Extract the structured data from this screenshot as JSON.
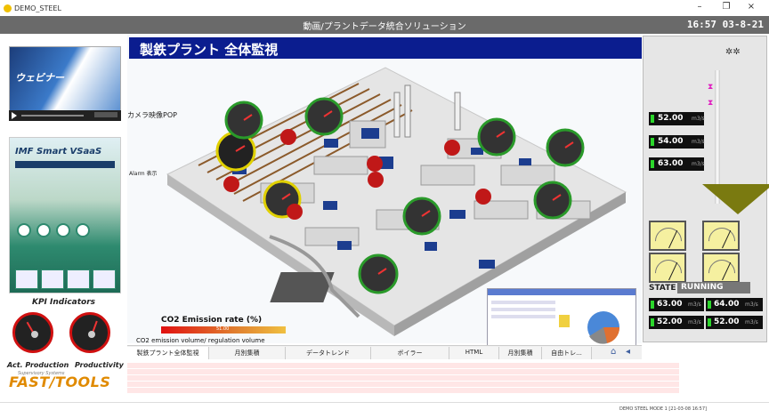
{
  "window": {
    "app_name": "DEMO_STEEL",
    "minimize": "–",
    "restore": "❐",
    "close": "×"
  },
  "banner": {
    "title": "動画/プラントデータ統合ソリューション",
    "clock": "16:57 03-8-21"
  },
  "left": {
    "video_text": "ウェビナー",
    "ad_title": "IMF Smart VSaaS",
    "kpi_title": "KPI Indicators",
    "kpi_labels": [
      "Act. Production",
      "Productivity"
    ],
    "brand": "FAST/TOOLS",
    "brand_sub": "Supervisory Systems"
  },
  "main": {
    "title": "製鉄プラント 全体監視",
    "camera_label": "カメラ映像POP",
    "alarm_label": "Alarm 表示",
    "co2_title": "CO2 Emission rate (%)",
    "co2_bar_value": "51.00",
    "co2_subtitle": "CO2 emission volume/ regulation volume"
  },
  "right": {
    "readings": [
      {
        "value": "52.00",
        "unit": "m3/s"
      },
      {
        "value": "54.00",
        "unit": "m3/s"
      },
      {
        "value": "63.00",
        "unit": "m3/s"
      }
    ],
    "state_label": "STATE",
    "state_value": "RUNNING",
    "bottom_readings": [
      {
        "value": "63.00",
        "unit": "m3/s"
      },
      {
        "value": "64.00",
        "unit": "m3/s"
      },
      {
        "value": "52.00",
        "unit": "m3/s"
      },
      {
        "value": "52.00",
        "unit": "m3/s"
      }
    ]
  },
  "tabs": [
    "製鉄プラント全体監視",
    "月別集積",
    "データトレンド",
    "ボイラー",
    "HTML",
    "月別集積",
    "自由トレ..."
  ],
  "status": {
    "text": "DEMO STEEL MODE 1 [21-03-08 16:57]"
  },
  "colors": {
    "banner": "#6a6a6a",
    "title_bar": "#0b1d8f",
    "ok_led": "#2bd62b",
    "alarm_row": "#ffe6e6"
  }
}
